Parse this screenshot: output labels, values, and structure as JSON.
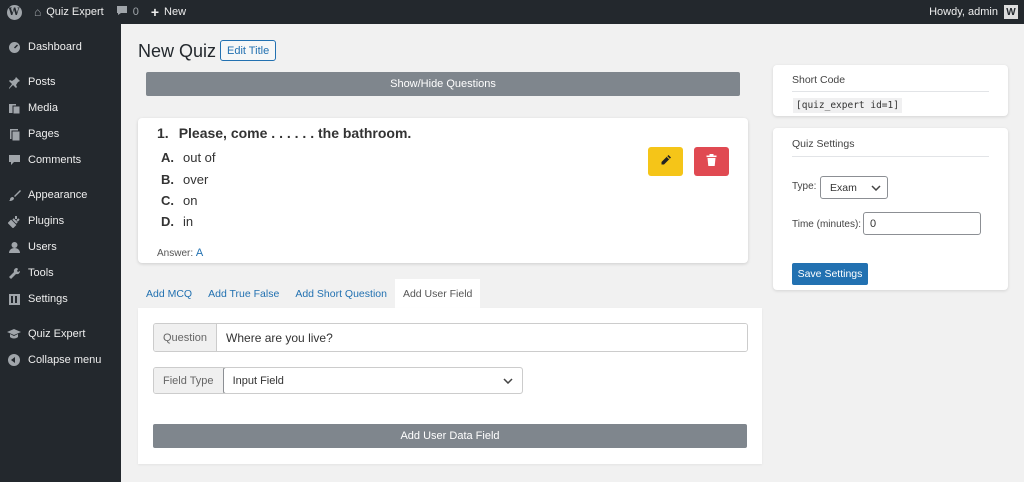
{
  "adminbar": {
    "site_name": "Quiz Expert",
    "comments_count": "0",
    "new_label": "New",
    "howdy": "Howdy, admin",
    "avatar_letter": "W"
  },
  "sidebar": {
    "items": [
      {
        "label": "Dashboard",
        "icon": "dashboard-icon"
      },
      {
        "label": "Posts",
        "icon": "pin-icon"
      },
      {
        "label": "Media",
        "icon": "media-icon"
      },
      {
        "label": "Pages",
        "icon": "pages-icon"
      },
      {
        "label": "Comments",
        "icon": "comment-icon"
      },
      {
        "label": "Appearance",
        "icon": "brush-icon"
      },
      {
        "label": "Plugins",
        "icon": "plug-icon"
      },
      {
        "label": "Users",
        "icon": "user-icon"
      },
      {
        "label": "Tools",
        "icon": "wrench-icon"
      },
      {
        "label": "Settings",
        "icon": "settings-icon"
      },
      {
        "label": "Quiz Expert",
        "icon": "graduation-cap-icon"
      },
      {
        "label": "Collapse menu",
        "icon": "collapse-icon"
      }
    ]
  },
  "main": {
    "title": "New Quiz",
    "edit_title_label": "Edit Title",
    "toggle_label": "Show/Hide Questions",
    "question": {
      "number": "1.",
      "text": "Please, come . . . . . . the bathroom.",
      "options": [
        {
          "letter": "A.",
          "text": "out of"
        },
        {
          "letter": "B.",
          "text": "over"
        },
        {
          "letter": "C.",
          "text": "on"
        },
        {
          "letter": "D.",
          "text": "in"
        }
      ],
      "answer_label": "Answer:",
      "answer_value": "A"
    },
    "tabs": [
      "Add MCQ",
      "Add True False",
      "Add Short Question",
      "Add User Field"
    ],
    "active_tab": "Add User Field",
    "form": {
      "question_label": "Question",
      "question_value": "Where are you live?",
      "field_type_label": "Field Type",
      "field_type_value": "Input Field",
      "submit_label": "Add User Data Field"
    }
  },
  "right": {
    "shortcode_title": "Short Code",
    "shortcode": "[quiz_expert id=1]",
    "settings_title": "Quiz Settings",
    "type_label": "Type:",
    "type_value": "Exam",
    "time_label": "Time (minutes):",
    "time_value": "0",
    "save_label": "Save Settings"
  },
  "colors": {
    "accent": "#2271b1",
    "edit_button": "#f5c518",
    "delete_button": "#e04a52",
    "admin_dark": "#23282d"
  }
}
